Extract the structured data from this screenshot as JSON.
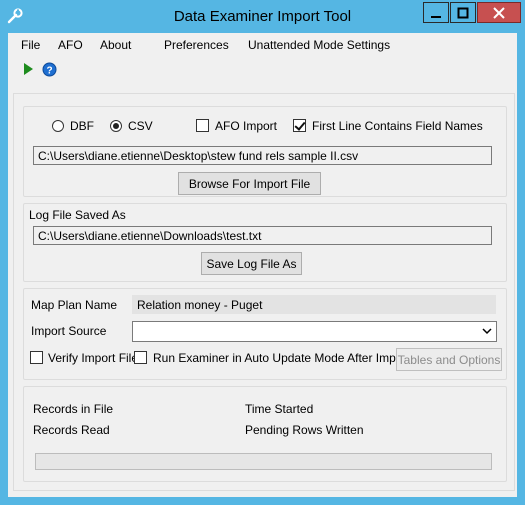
{
  "window": {
    "title": "Data Examiner Import Tool"
  },
  "menu": {
    "items": [
      "File",
      "AFO",
      "About",
      "Preferences",
      "Unattended Mode Settings"
    ]
  },
  "import_group": {
    "format_dbf_label": "DBF",
    "format_csv_label": "CSV",
    "selected_format": "CSV",
    "afo_import_label": "AFO Import",
    "afo_import_checked": false,
    "first_line_label": "First Line Contains Field Names",
    "first_line_checked": true,
    "file_path": "C:\\Users\\diane.etienne\\Desktop\\stew fund rels sample II.csv",
    "browse_button": "Browse For Import File"
  },
  "log_group": {
    "title": "Log File Saved As",
    "file_path": "C:\\Users\\diane.etienne\\Downloads\\test.txt",
    "save_button": "Save Log File As"
  },
  "map_group": {
    "map_plan_label": "Map Plan Name",
    "map_plan_value": "Relation money - Puget",
    "import_source_label": "Import Source",
    "import_source_value": "",
    "verify_label": "Verify Import File",
    "verify_checked": false,
    "run_examiner_label": "Run Examiner in Auto Update Mode After Import",
    "run_examiner_checked": false,
    "tables_button": "Tables and Options"
  },
  "status_group": {
    "records_in_file_label": "Records in File",
    "records_read_label": "Records Read",
    "time_started_label": "Time Started",
    "pending_rows_label": "Pending Rows Written",
    "progress": 0
  },
  "colors": {
    "titlebar": "#55b6e3",
    "close_button": "#c75050",
    "play_icon": "#1e8c1e",
    "help_icon": "#1f6fd1"
  }
}
